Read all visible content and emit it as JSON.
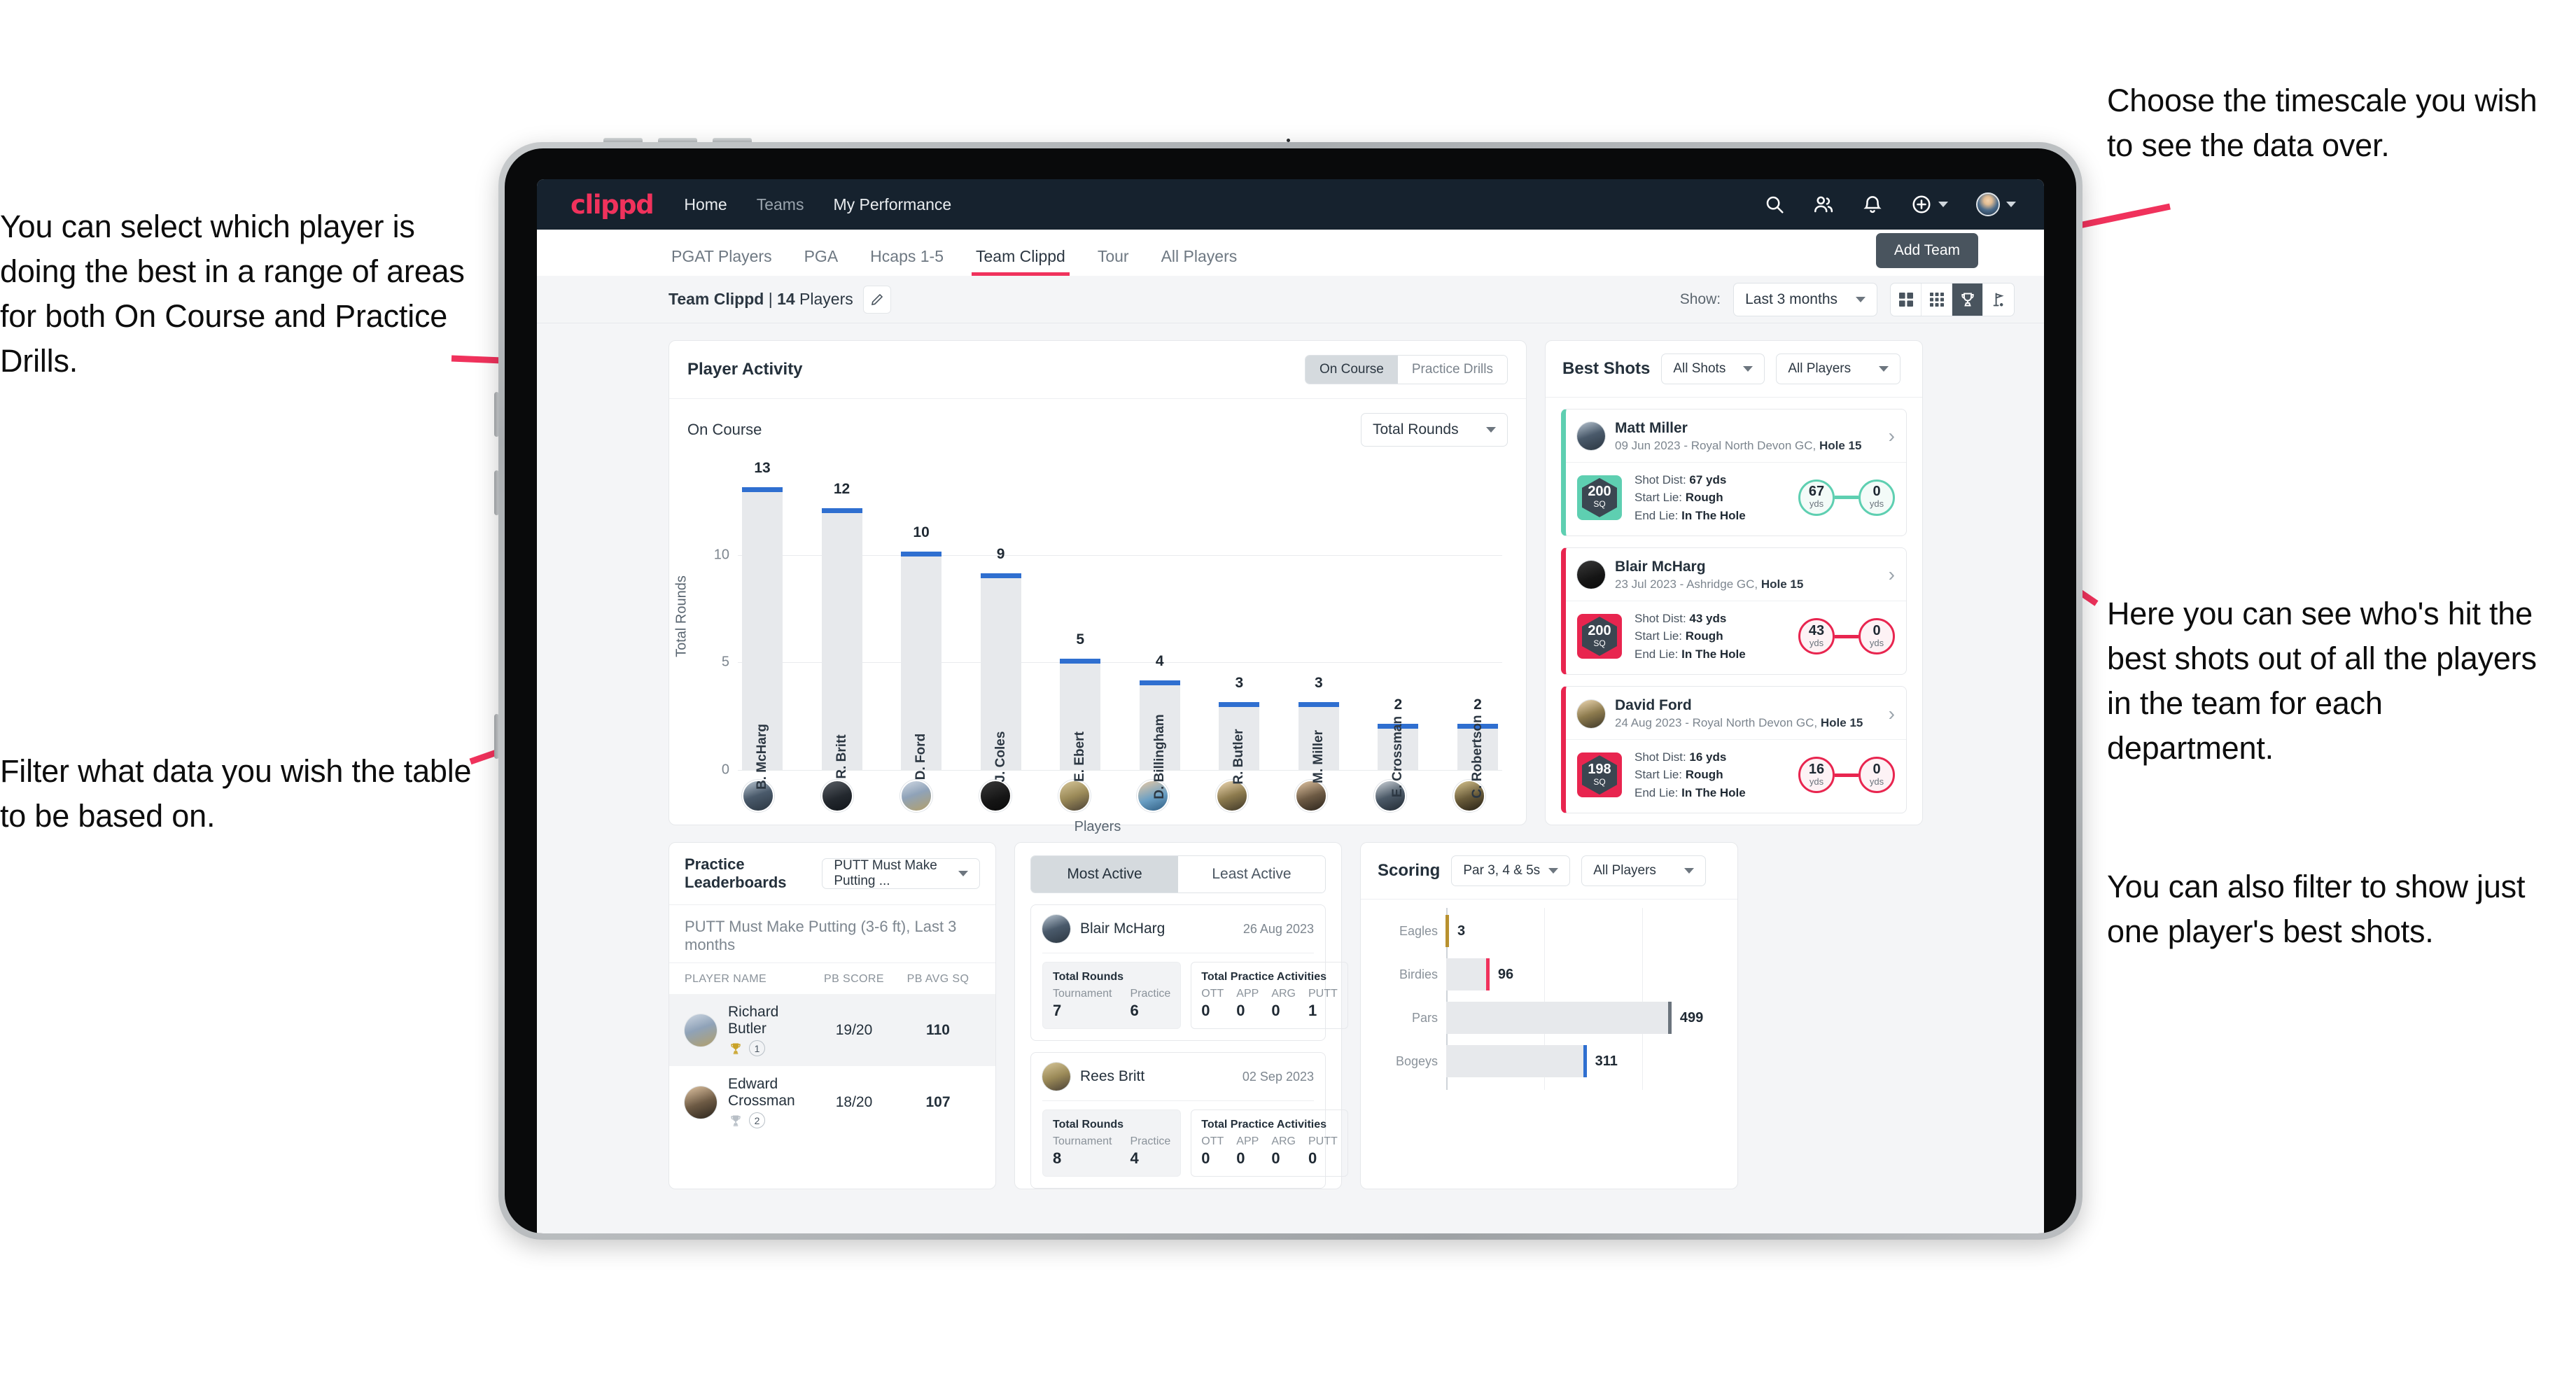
{
  "annotations": {
    "top_right": "Choose the timescale you wish to see the data over.",
    "left_top": "You can select which player is doing the best in a range of areas for both On Course and Practice Drills.",
    "left_bottom": "Filter what data you wish the table to be based on.",
    "right_mid": "Here you can see who's hit the best shots out of all the players in the team for each department.",
    "right_bottom": "You can also filter to show just one player's best shots."
  },
  "colors": {
    "brand_pink": "#f0325c",
    "nav_dark": "#16222e",
    "bar_blue": "#2f6fd0",
    "teal": "#5ecfb1",
    "gold": "#b8912f"
  },
  "topnav": {
    "logo": "clippd",
    "links": [
      {
        "label": "Home",
        "dim": false
      },
      {
        "label": "Teams",
        "dim": true
      },
      {
        "label": "My Performance",
        "dim": false
      }
    ],
    "icons": [
      "search-icon",
      "people-icon",
      "bell-icon",
      "plus-circle-icon",
      "avatar"
    ]
  },
  "tabs": [
    {
      "label": "PGAT Players",
      "active": false
    },
    {
      "label": "PGA",
      "active": false
    },
    {
      "label": "Hcaps 1-5",
      "active": false
    },
    {
      "label": "Team Clippd",
      "active": true
    },
    {
      "label": "Tour",
      "active": false
    },
    {
      "label": "All Players",
      "active": false
    }
  ],
  "add_team_label": "Add Team",
  "subbar": {
    "team_name": "Team Clippd",
    "separator": " | ",
    "player_count": "14",
    "players_word": " Players",
    "show_label": "Show:",
    "timescale_value": "Last 3 months",
    "view_toggles": [
      {
        "name": "grid-2x2-icon",
        "on": false
      },
      {
        "name": "grid-3x3-icon",
        "on": false
      },
      {
        "name": "trophy-icon",
        "on": true
      },
      {
        "name": "golf-flag-icon",
        "on": false
      }
    ]
  },
  "player_activity": {
    "title": "Player Activity",
    "segments": [
      {
        "label": "On Course",
        "on": true
      },
      {
        "label": "Practice Drills",
        "on": false
      }
    ],
    "sub_label": "On Course",
    "metric_value": "Total Rounds"
  },
  "chart_data": [
    {
      "type": "bar",
      "title": "Player Activity - On Course",
      "categories": [
        "B. McHarg",
        "R. Britt",
        "D. Ford",
        "J. Coles",
        "E. Ebert",
        "D. Billingham",
        "R. Butler",
        "M. Miller",
        "E. Crossman",
        "C. Robertson"
      ],
      "values": [
        13,
        12,
        10,
        9,
        5,
        4,
        3,
        3,
        2,
        2
      ],
      "xlabel": "Players",
      "ylabel": "Total Rounds",
      "yticks": [
        0,
        5,
        10
      ],
      "ylim": [
        0,
        14
      ],
      "grid": true,
      "legend": "none"
    },
    {
      "type": "bar",
      "orientation": "horizontal",
      "title": "Scoring",
      "categories": [
        "Eagles",
        "Birdies",
        "Pars",
        "Bogeys"
      ],
      "values": [
        3,
        96,
        499,
        311
      ],
      "value_labels": [
        "3",
        "96",
        "499",
        "311"
      ],
      "cap_colors": [
        "#b8912f",
        "#f0325c",
        "#6b747d",
        "#2f6fd0"
      ],
      "xlabel": "",
      "ylabel": "",
      "xlim": [
        0,
        620
      ],
      "grid": true,
      "legend": "none"
    }
  ],
  "best_shots": {
    "title": "Best Shots",
    "filter_shots": "All Shots",
    "filter_players": "All Players",
    "cards": [
      {
        "player": "Matt Miller",
        "meta_date": "09 Jun 2023",
        "meta_sep": " - ",
        "meta_course": "Royal North Devon GC, ",
        "meta_hole": "Hole 15",
        "sq": "200",
        "sq_unit": "SQ",
        "accent": "#5ecfb1",
        "shot_dist_label": "Shot Dist: ",
        "shot_dist": "67 yds",
        "start_lie_label": "Start Lie: ",
        "start_lie": "Rough",
        "end_lie_label": "End Lie: ",
        "end_lie": "In The Hole",
        "from_val": "67",
        "from_unit": "yds",
        "to_val": "0",
        "to_unit": "yds"
      },
      {
        "player": "Blair McHarg",
        "meta_date": "23 Jul 2023",
        "meta_sep": " - ",
        "meta_course": "Ashridge GC, ",
        "meta_hole": "Hole 15",
        "sq": "200",
        "sq_unit": "SQ",
        "accent": "#e8254f",
        "shot_dist_label": "Shot Dist: ",
        "shot_dist": "43 yds",
        "start_lie_label": "Start Lie: ",
        "start_lie": "Rough",
        "end_lie_label": "End Lie: ",
        "end_lie": "In The Hole",
        "from_val": "43",
        "from_unit": "yds",
        "to_val": "0",
        "to_unit": "yds"
      },
      {
        "player": "David Ford",
        "meta_date": "24 Aug 2023",
        "meta_sep": " - ",
        "meta_course": "Royal North Devon GC, ",
        "meta_hole": "Hole 15",
        "sq": "198",
        "sq_unit": "SQ",
        "accent": "#e8254f",
        "shot_dist_label": "Shot Dist: ",
        "shot_dist": "16 yds",
        "start_lie_label": "Start Lie: ",
        "start_lie": "Rough",
        "end_lie_label": "End Lie: ",
        "end_lie": "In The Hole",
        "from_val": "16",
        "from_unit": "yds",
        "to_val": "0",
        "to_unit": "yds"
      }
    ]
  },
  "practice_leaderboards": {
    "title": "Practice Leaderboards",
    "drill_select": "PUTT Must Make Putting ...",
    "subtitle_bold": "PUTT Must Make Putting (3-6 ft),",
    "subtitle_light": " Last 3 months",
    "columns": [
      "PLAYER NAME",
      "PB SCORE",
      "PB AVG SQ"
    ],
    "rows": [
      {
        "name": "Richard Butler",
        "rank": "1",
        "trophy": "gold",
        "pb_score": "19/20",
        "pb_avg_sq": "110",
        "highlight": true
      },
      {
        "name": "Edward Crossman",
        "rank": "2",
        "trophy": "silver",
        "pb_score": "18/20",
        "pb_avg_sq": "107",
        "highlight": false
      }
    ]
  },
  "activity": {
    "tabs": [
      {
        "label": "Most Active",
        "on": true
      },
      {
        "label": "Least Active",
        "on": false
      }
    ],
    "rounds_title": "Total Rounds",
    "rounds_keys": [
      "Tournament",
      "Practice"
    ],
    "practice_title": "Total Practice Activities",
    "practice_keys": [
      "OTT",
      "APP",
      "ARG",
      "PUTT"
    ],
    "cards": [
      {
        "player": "Blair McHarg",
        "date": "26 Aug 2023",
        "rounds": [
          "7",
          "6"
        ],
        "practice": [
          "0",
          "0",
          "0",
          "1"
        ]
      },
      {
        "player": "Rees Britt",
        "date": "02 Sep 2023",
        "rounds": [
          "8",
          "4"
        ],
        "practice": [
          "0",
          "0",
          "0",
          "0"
        ]
      }
    ]
  },
  "scoring": {
    "title": "Scoring",
    "filter_par": "Par 3, 4 & 5s",
    "filter_players": "All Players"
  }
}
